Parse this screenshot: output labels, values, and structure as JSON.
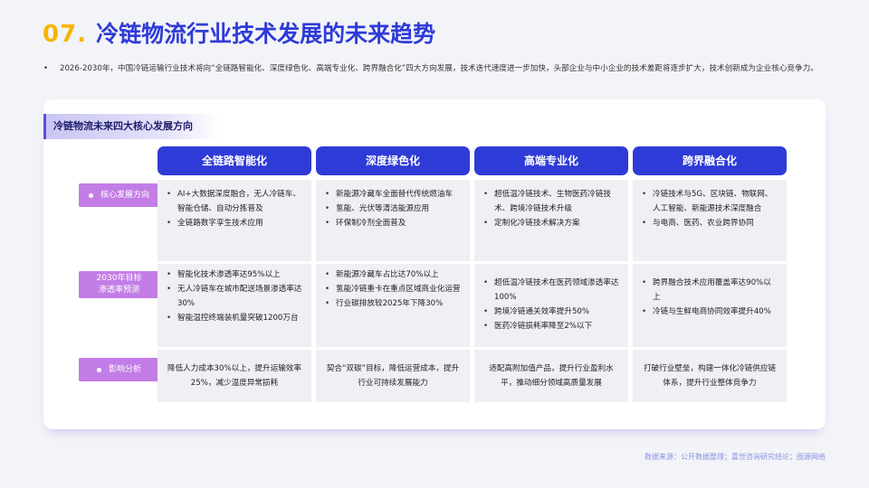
{
  "header": {
    "number": "07.",
    "title": "冷链物流行业技术发展的未来趋势"
  },
  "intro": "2026-2030年，中国冷链运输行业技术将向“全链路智能化、深度绿色化、高端专业化、跨界融合化”四大方向发展，技术迭代速度进一步加快，头部企业与中小企业的技术差距将逐步扩大，技术创新成为企业核心竞争力。",
  "section_tag": "冷链物流未来四大核心发展方向",
  "columns": [
    "全链路智能化",
    "深度绿色化",
    "高端专业化",
    "跨界融合化"
  ],
  "rows": [
    {
      "label": "核心发展方向",
      "cells": [
        [
          "AI+大数据深度融合，无人冷链车、智能仓储、自动分拣普及",
          "全链路数字孪生技术应用"
        ],
        [
          "新能源冷藏车全面替代传统燃油车",
          "氢能、光伏等清洁能源应用",
          "环保制冷剂全面普及"
        ],
        [
          "超低温冷链技术、生物医药冷链技术、跨境冷链技术升级",
          "定制化冷链技术解决方案"
        ],
        [
          "冷链技术与5G、区块链、物联网、人工智能、新能源技术深度融合",
          "与电商、医药、农业跨界协同"
        ]
      ]
    },
    {
      "label": "2030年目标渗透率预测",
      "label_lines": [
        "2030年目标",
        "渗透率预测"
      ],
      "cells": [
        [
          "智能化技术渗透率达95%以上",
          "无人冷链车在城市配送场景渗透率达30%",
          "智能温控终端装机量突破1200万台"
        ],
        [
          "新能源冷藏车占比达70%以上",
          "氢能冷链重卡在重点区域商业化运营",
          "行业碳排放较2025年下降30%"
        ],
        [
          "超低温冷链技术在医药领域渗透率达100%",
          "跨境冷链通关效率提升50%",
          "医药冷链损耗率降至2%以下"
        ],
        [
          "跨界融合技术应用覆盖率达90%以上",
          "冷链与生鲜电商协同效率提升40%"
        ]
      ]
    },
    {
      "label": "影响分析",
      "cells": [
        "降低人力成本30%以上，提升运输效率25%，减少温度异常损耗",
        "契合“双碳”目标，降低运营成本，提升行业可持续发展能力",
        "适配高附加值产品，提升行业盈利水平，推动细分领域高质量发展",
        "打破行业壁垒，构建一体化冷链供应链体系，提升行业整体竞争力"
      ]
    }
  ],
  "source": "数据来源：公开数据整理；嘉世咨询研究结论；图源网络",
  "colors": {
    "accent_blue": "#2f3bd6",
    "accent_yellow": "#f7b500",
    "row_label_purple": "#c37de6",
    "cell_bg": "#eff0f4"
  }
}
